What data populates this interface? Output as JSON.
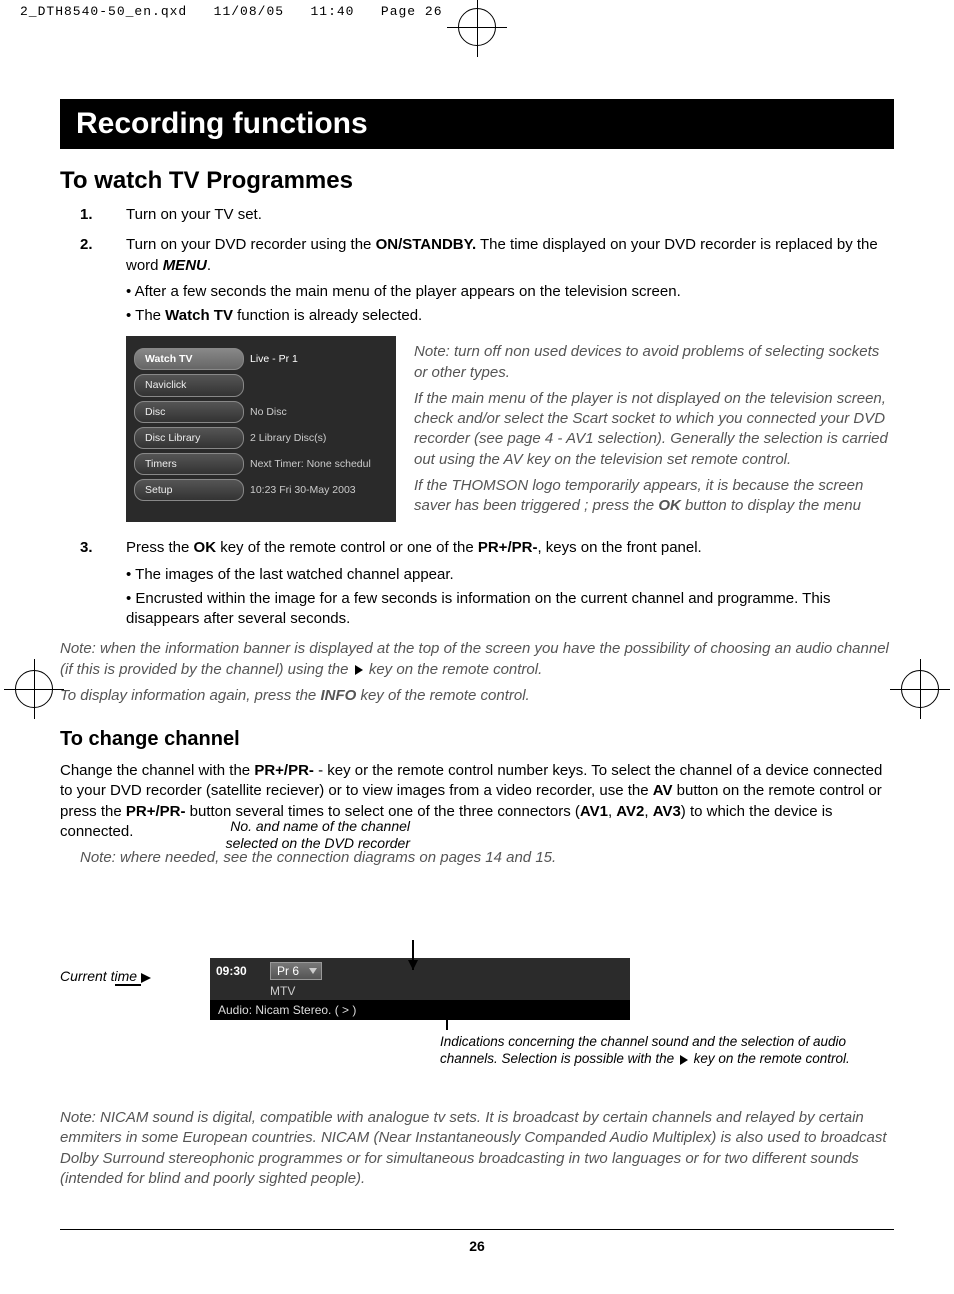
{
  "qxd": {
    "filename": "2_DTH8540-50_en.qxd",
    "date": "11/08/05",
    "time": "11:40",
    "page_label": "Page 26"
  },
  "titlebar": "Recording functions",
  "section1": {
    "heading": "To watch TV Programmes",
    "step1_num": "1.",
    "step1": "Turn on your TV set.",
    "step2_num": "2.",
    "step2_a": "Turn on your DVD recorder using the ",
    "step2_b": "ON/STANDBY.",
    "step2_c": " The time displayed on your DVD recorder is replaced by the word ",
    "step2_d": "MENU",
    "step2_e": ".",
    "step2_bullets": [
      "After a few seconds the main menu of the player appears on the television screen.",
      [
        "The ",
        "Watch TV",
        " function is already selected."
      ]
    ],
    "menu": {
      "items": [
        {
          "label": "Watch TV",
          "value": "Live - Pr 1",
          "selected": true
        },
        {
          "label": "Naviclick",
          "value": ""
        },
        {
          "label": "Disc",
          "value": "No Disc"
        },
        {
          "label": "Disc Library",
          "value": "2 Library Disc(s)"
        },
        {
          "label": "Timers",
          "value": "Next Timer: None schedul"
        },
        {
          "label": "Setup",
          "value": "10:23 Fri 30-May 2003"
        }
      ]
    },
    "menu_notes": [
      "Note: turn off non used devices to avoid problems of selecting sockets or other types.",
      "If the main menu of the player is not displayed on the television screen, check and/or select the Scart socket to which you connected your DVD recorder (see page 4 - AV1 selection). Generally the selection is carried out using the AV key on the television set remote control.",
      [
        "If the THOMSON logo temporarily appears, it is because the screen saver has been triggered ; press the ",
        "OK",
        " button to display the menu"
      ]
    ],
    "step3_num": "3.",
    "step3_a": "Press the ",
    "step3_b": "OK",
    "step3_c": " key of the remote control or one of the ",
    "step3_d": "PR+/PR-",
    "step3_e": ", keys on the front panel.",
    "step3_bullets": [
      "The images of the last watched channel appear.",
      "Encrusted within the image for a few seconds is information on the current channel and programme. This disappears after several seconds."
    ],
    "step3_note1_a": "Note: when the information banner is displayed at the top of the screen you have the possibility of choosing an audio channel (if this is provided by the channel) using the ",
    "step3_note1_b": " key on the remote control.",
    "step3_note2_a": "To display information again, press the ",
    "step3_note2_b": "INFO",
    "step3_note2_c": " key of the remote control."
  },
  "section2": {
    "heading": "To change channel",
    "para_parts": [
      "Change the channel with the ",
      "PR+/PR-",
      " - key or the remote control number keys. To select the channel of a device connected to your DVD recorder (satellite reciever) or to view images from a video recorder, use the ",
      "AV",
      " button on the remote control or press the ",
      "PR+/PR-",
      " button several times to select one of the three connectors (",
      "AV1",
      ", ",
      "AV2",
      ", ",
      "AV3",
      ") to which the device is connected."
    ],
    "note": "Note: where needed, see the connection diagrams on pages 14 and 15.",
    "banner_top_label": "No. and name of the channel selected on the DVD recorder",
    "current_time_label": "Current time",
    "banner": {
      "time": "09:30",
      "pr": "Pr  6",
      "name": "MTV",
      "audio": "Audio: Nicam Stereo.  ( > )"
    },
    "banner_caption_a": "Indications concerning the channel sound and the selection of audio channels. Selection is possible with the ",
    "banner_caption_b": " key on the remote control.",
    "nicam_note": "Note: NICAM sound is digital, compatible with analogue tv sets. It is broadcast by certain channels and relayed by certain emmiters in some European countries. NICAM (Near Instantaneously Companded Audio Multiplex) is also used to broadcast Dolby Surround stereophonic programmes or for simultaneous broadcasting in two languages or for two different sounds (intended for blind and poorly sighted people)."
  },
  "page_number": "26"
}
